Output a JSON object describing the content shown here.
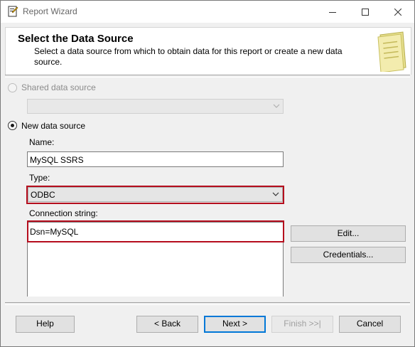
{
  "window": {
    "title": "Report Wizard",
    "icon": "report-wizard-icon"
  },
  "header": {
    "title": "Select the Data Source",
    "description": "Select a data source from which to obtain data for this report or create a new data source."
  },
  "shared_source": {
    "label": "Shared data source",
    "selected": false,
    "enabled": false,
    "value": ""
  },
  "new_source": {
    "label": "New data source",
    "selected": true,
    "name_label": "Name:",
    "name_value": "MySQL SSRS",
    "type_label": "Type:",
    "type_value": "ODBC",
    "conn_label": "Connection string:",
    "conn_value": "Dsn=MySQL"
  },
  "side_buttons": {
    "edit": "Edit...",
    "credentials": "Credentials..."
  },
  "footer": {
    "help": "Help",
    "back": "< Back",
    "next": "Next >",
    "finish": "Finish >>|",
    "cancel": "Cancel"
  },
  "colors": {
    "highlight": "#b50d1d",
    "default_button": "#0078d7"
  }
}
